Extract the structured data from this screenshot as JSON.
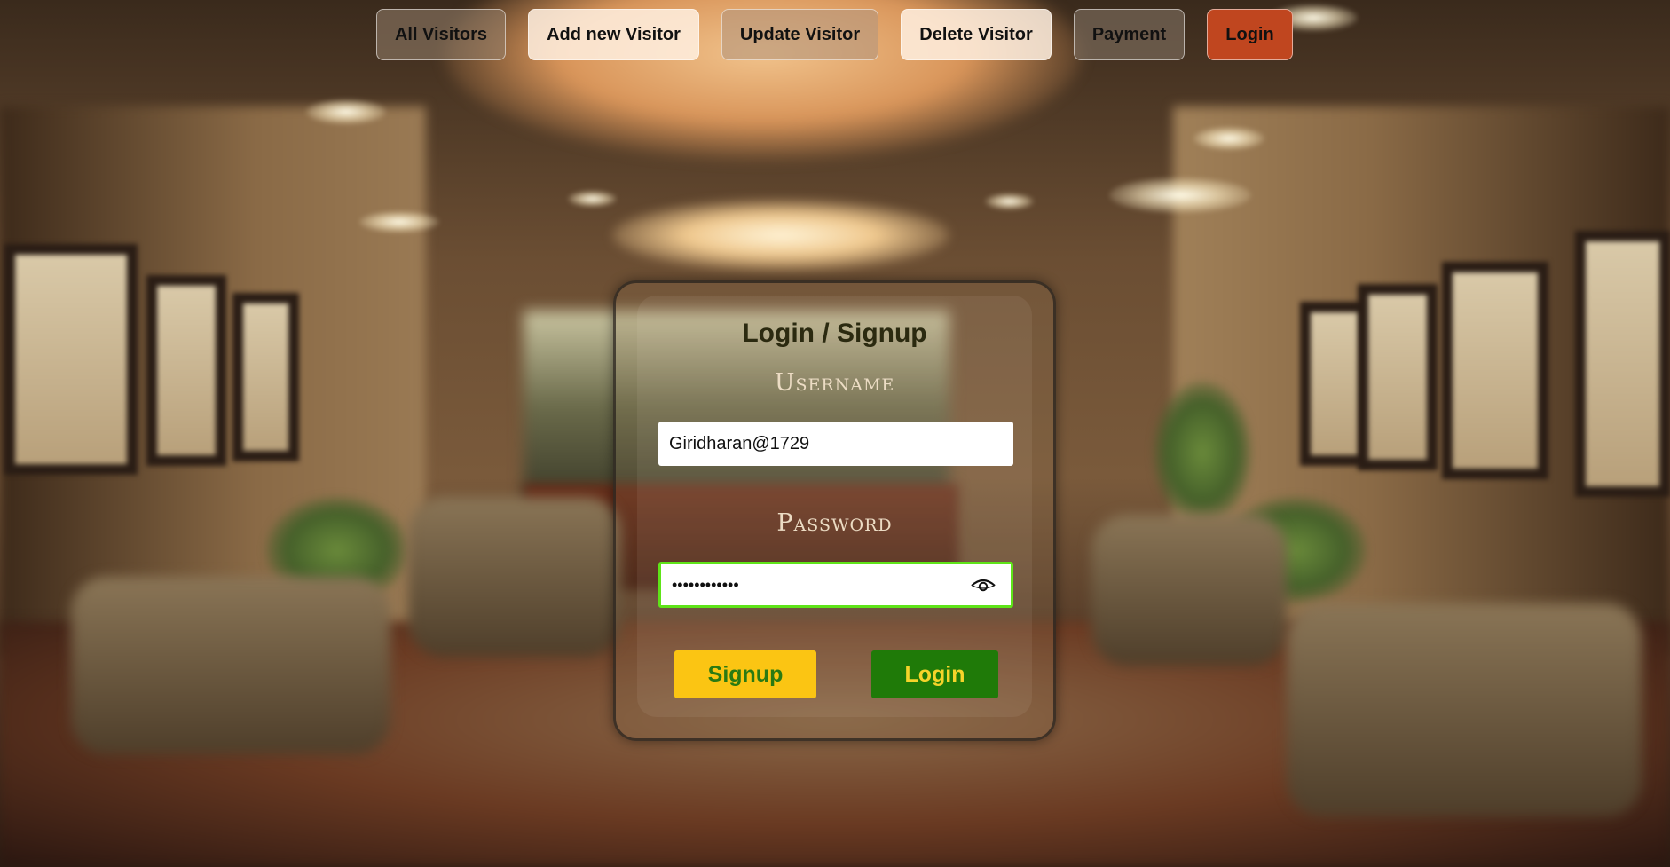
{
  "nav": {
    "items": [
      {
        "label": "All Visitors"
      },
      {
        "label": "Add new Visitor"
      },
      {
        "label": "Update Visitor"
      },
      {
        "label": "Delete Visitor"
      },
      {
        "label": "Payment"
      },
      {
        "label": "Login"
      }
    ]
  },
  "card": {
    "title": "Login / Signup",
    "username_label": "Username",
    "username_value": "Giridharan@1729",
    "password_label": "Password",
    "password_value": "••••••••••••",
    "signup_label": "Signup",
    "login_label": "Login"
  },
  "colors": {
    "signup_bg": "#fbc513",
    "signup_text": "#2a7a12",
    "login_bg": "#1f7a08",
    "login_text": "#f5d42a",
    "active_nav": "#c0461f",
    "focus_border": "#5ee418"
  }
}
